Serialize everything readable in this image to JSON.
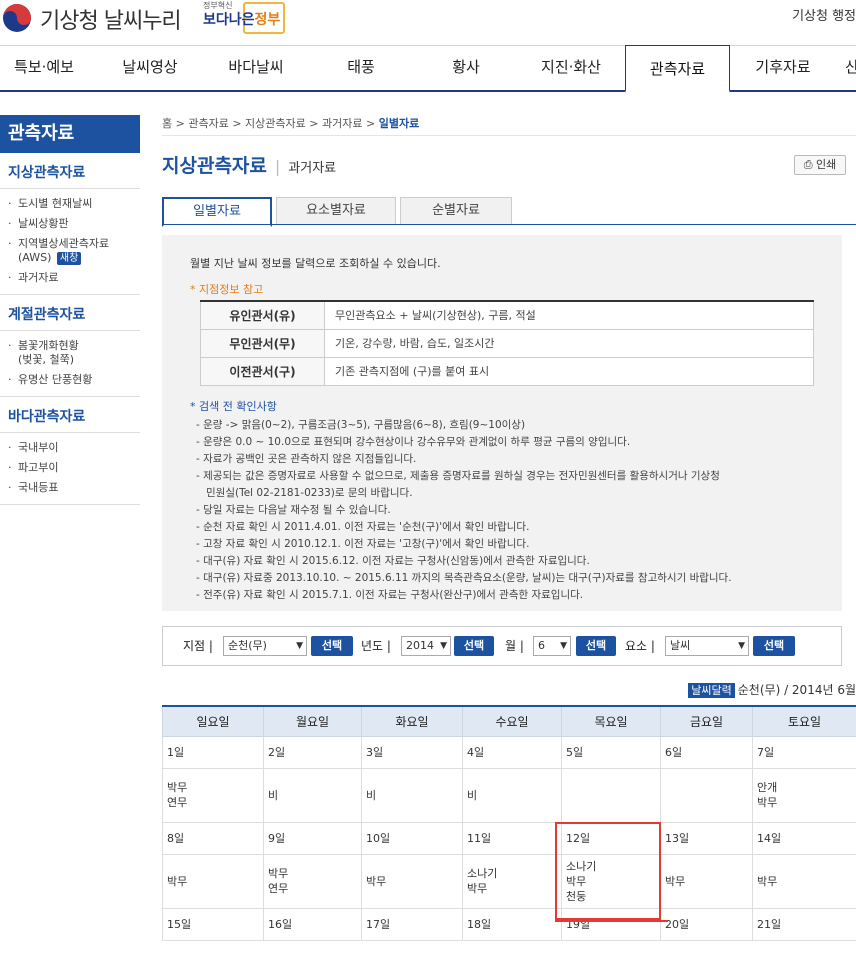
{
  "header": {
    "logo_text": "기상청 날씨누리",
    "gov_small": "정부혁신",
    "gov_main_a": "보다나은",
    "gov_main_b": "정부",
    "right_text": "기상청 행정"
  },
  "nav": [
    "특보·예보",
    "날씨영상",
    "바다날씨",
    "태풍",
    "황사",
    "지진·화산",
    "관측자료",
    "기후자료",
    "산"
  ],
  "sidebar": {
    "title": "관측자료",
    "cat1": "지상관측자료",
    "cat1_items": [
      "도시별 현재날씨",
      "날씨상황판",
      "지역별상세관측자료",
      "(AWS)",
      "과거자료"
    ],
    "new_badge": "새창",
    "cat2": "계절관측자료",
    "cat2_items": [
      "봄꽃개화현황",
      "(벚꽃, 철쭉)",
      "유명산 단풍현황"
    ],
    "cat3": "바다관측자료",
    "cat3_items": [
      "국내부이",
      "파고부이",
      "국내등표"
    ]
  },
  "breadcrumb": {
    "home": "홈",
    "b1": "관측자료",
    "b2": "지상관측자료",
    "b3": "과거자료",
    "current": "일별자료"
  },
  "title": {
    "main": "지상관측자료",
    "sub": "과거자료",
    "print": "인쇄"
  },
  "tabs": [
    "일별자료",
    "요소별자료",
    "순별자료"
  ],
  "info": {
    "intro": "월별 지난 날씨 정보를 달력으로 조회하실 수 있습니다.",
    "note_title": "* 지점정보 참고",
    "stations": [
      {
        "h": "유인관서(유)",
        "v": "무인관측요소 + 날씨(기상현상), 구름, 적설"
      },
      {
        "h": "무인관서(무)",
        "v": "기온, 강수량, 바람, 습도, 일조시간"
      },
      {
        "h": "이전관서(구)",
        "v": "기존 관측지점에 (구)를 붙여 표시"
      }
    ],
    "check_title": "* 검색 전 확인사항",
    "checks": [
      "- 운량 -> 맑음(0~2), 구름조금(3~5), 구름많음(6~8), 흐림(9~10이상)",
      "- 운량은 0.0 ~ 10.0으로 표현되며 강수현상이나 강수유무와 관계없이 하루 평균 구름의 양입니다.",
      "- 자료가 공백인 곳은 관측하지 않은 지점들입니다.",
      "- 제공되는 값은 증명자료로 사용할 수 없으므로, 제출용 증명자료를 원하실 경우는 전자민원센터를 활용하시거나 기상청",
      "  민원실(Tel 02-2181-0233)로 문의 바랍니다.",
      "- 당일 자료는 다음날 재수정 될 수 있습니다.",
      "- 순천 자료 확인 시 2011.4.01. 이전 자료는 '순천(구)'에서 확인 바랍니다.",
      "- 고창 자료 확인 시 2010.12.1. 이전 자료는 '고창(구)'에서 확인 바랍니다.",
      "- 대구(유) 자료 확인 시 2015.6.12. 이전 자료는 구청사(신암동)에서 관측한 자료입니다.",
      "- 대구(유) 자료중 2013.10.10. ~ 2015.6.11 까지의 목측관측요소(운량, 날씨)는 대구(구)자료를 참고하시기 바랍니다.",
      "- 전주(유) 자료 확인 시 2015.7.1. 이전 자료는 구청사(완산구)에서 관측한 자료입니다."
    ]
  },
  "search": {
    "station_label": "지점 |",
    "station_value": "순천(무)",
    "year_label": "년도 |",
    "year_value": "2014",
    "month_label": "월 |",
    "month_value": "6",
    "element_label": "요소 |",
    "element_value": "날씨",
    "select_button": "선택"
  },
  "calendar": {
    "tag": "날씨달력",
    "caption": "순천(무) / 2014년 6월",
    "weekdays": [
      "일요일",
      "월요일",
      "화요일",
      "수요일",
      "목요일",
      "금요일",
      "토요일"
    ],
    "weeks": [
      {
        "days": [
          "1일",
          "2일",
          "3일",
          "4일",
          "5일",
          "6일",
          "7일"
        ],
        "wx": [
          [
            "박무",
            "연무"
          ],
          [
            "비"
          ],
          [
            "비"
          ],
          [
            "비"
          ],
          [],
          [],
          [
            "안개",
            "박무"
          ]
        ]
      },
      {
        "days": [
          "8일",
          "9일",
          "10일",
          "11일",
          "12일",
          "13일",
          "14일"
        ],
        "wx": [
          [
            "박무"
          ],
          [
            "박무",
            "연무"
          ],
          [
            "박무"
          ],
          [
            "소나기",
            "박무"
          ],
          [
            "소나기",
            "박무",
            "천둥"
          ],
          [
            "박무"
          ],
          [
            "박무"
          ]
        ]
      },
      {
        "days": [
          "15일",
          "16일",
          "17일",
          "18일",
          "19일",
          "20일",
          "21일"
        ],
        "wx": []
      }
    ]
  }
}
